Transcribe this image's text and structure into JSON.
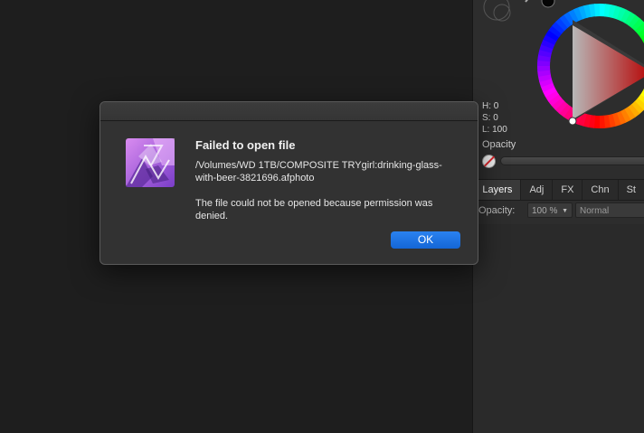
{
  "dialog": {
    "title": "Failed to open file",
    "path": "/Volumes/WD  1TB/COMPOSITE TRYgirl:drinking-glass-with-beer-3821696.afphoto",
    "message": "The file could not be opened because permission was denied.",
    "ok_label": "OK",
    "app_icon": "affinity-photo-icon"
  },
  "color_panel": {
    "h": "H: 0",
    "s": "S: 0",
    "l": "L: 100",
    "opacity_label": "Opacity"
  },
  "tabs": [
    {
      "label": "Layers",
      "active": true
    },
    {
      "label": "Adj"
    },
    {
      "label": "FX"
    },
    {
      "label": "Chn"
    },
    {
      "label": "St"
    }
  ],
  "layer_options": {
    "opacity_label": "Opacity:",
    "opacity_value": "100 %",
    "blend_mode": "Normal"
  },
  "colors": {
    "accent": "#1a6fe0",
    "background": "#1e1e1e",
    "dialog": "#323232"
  }
}
